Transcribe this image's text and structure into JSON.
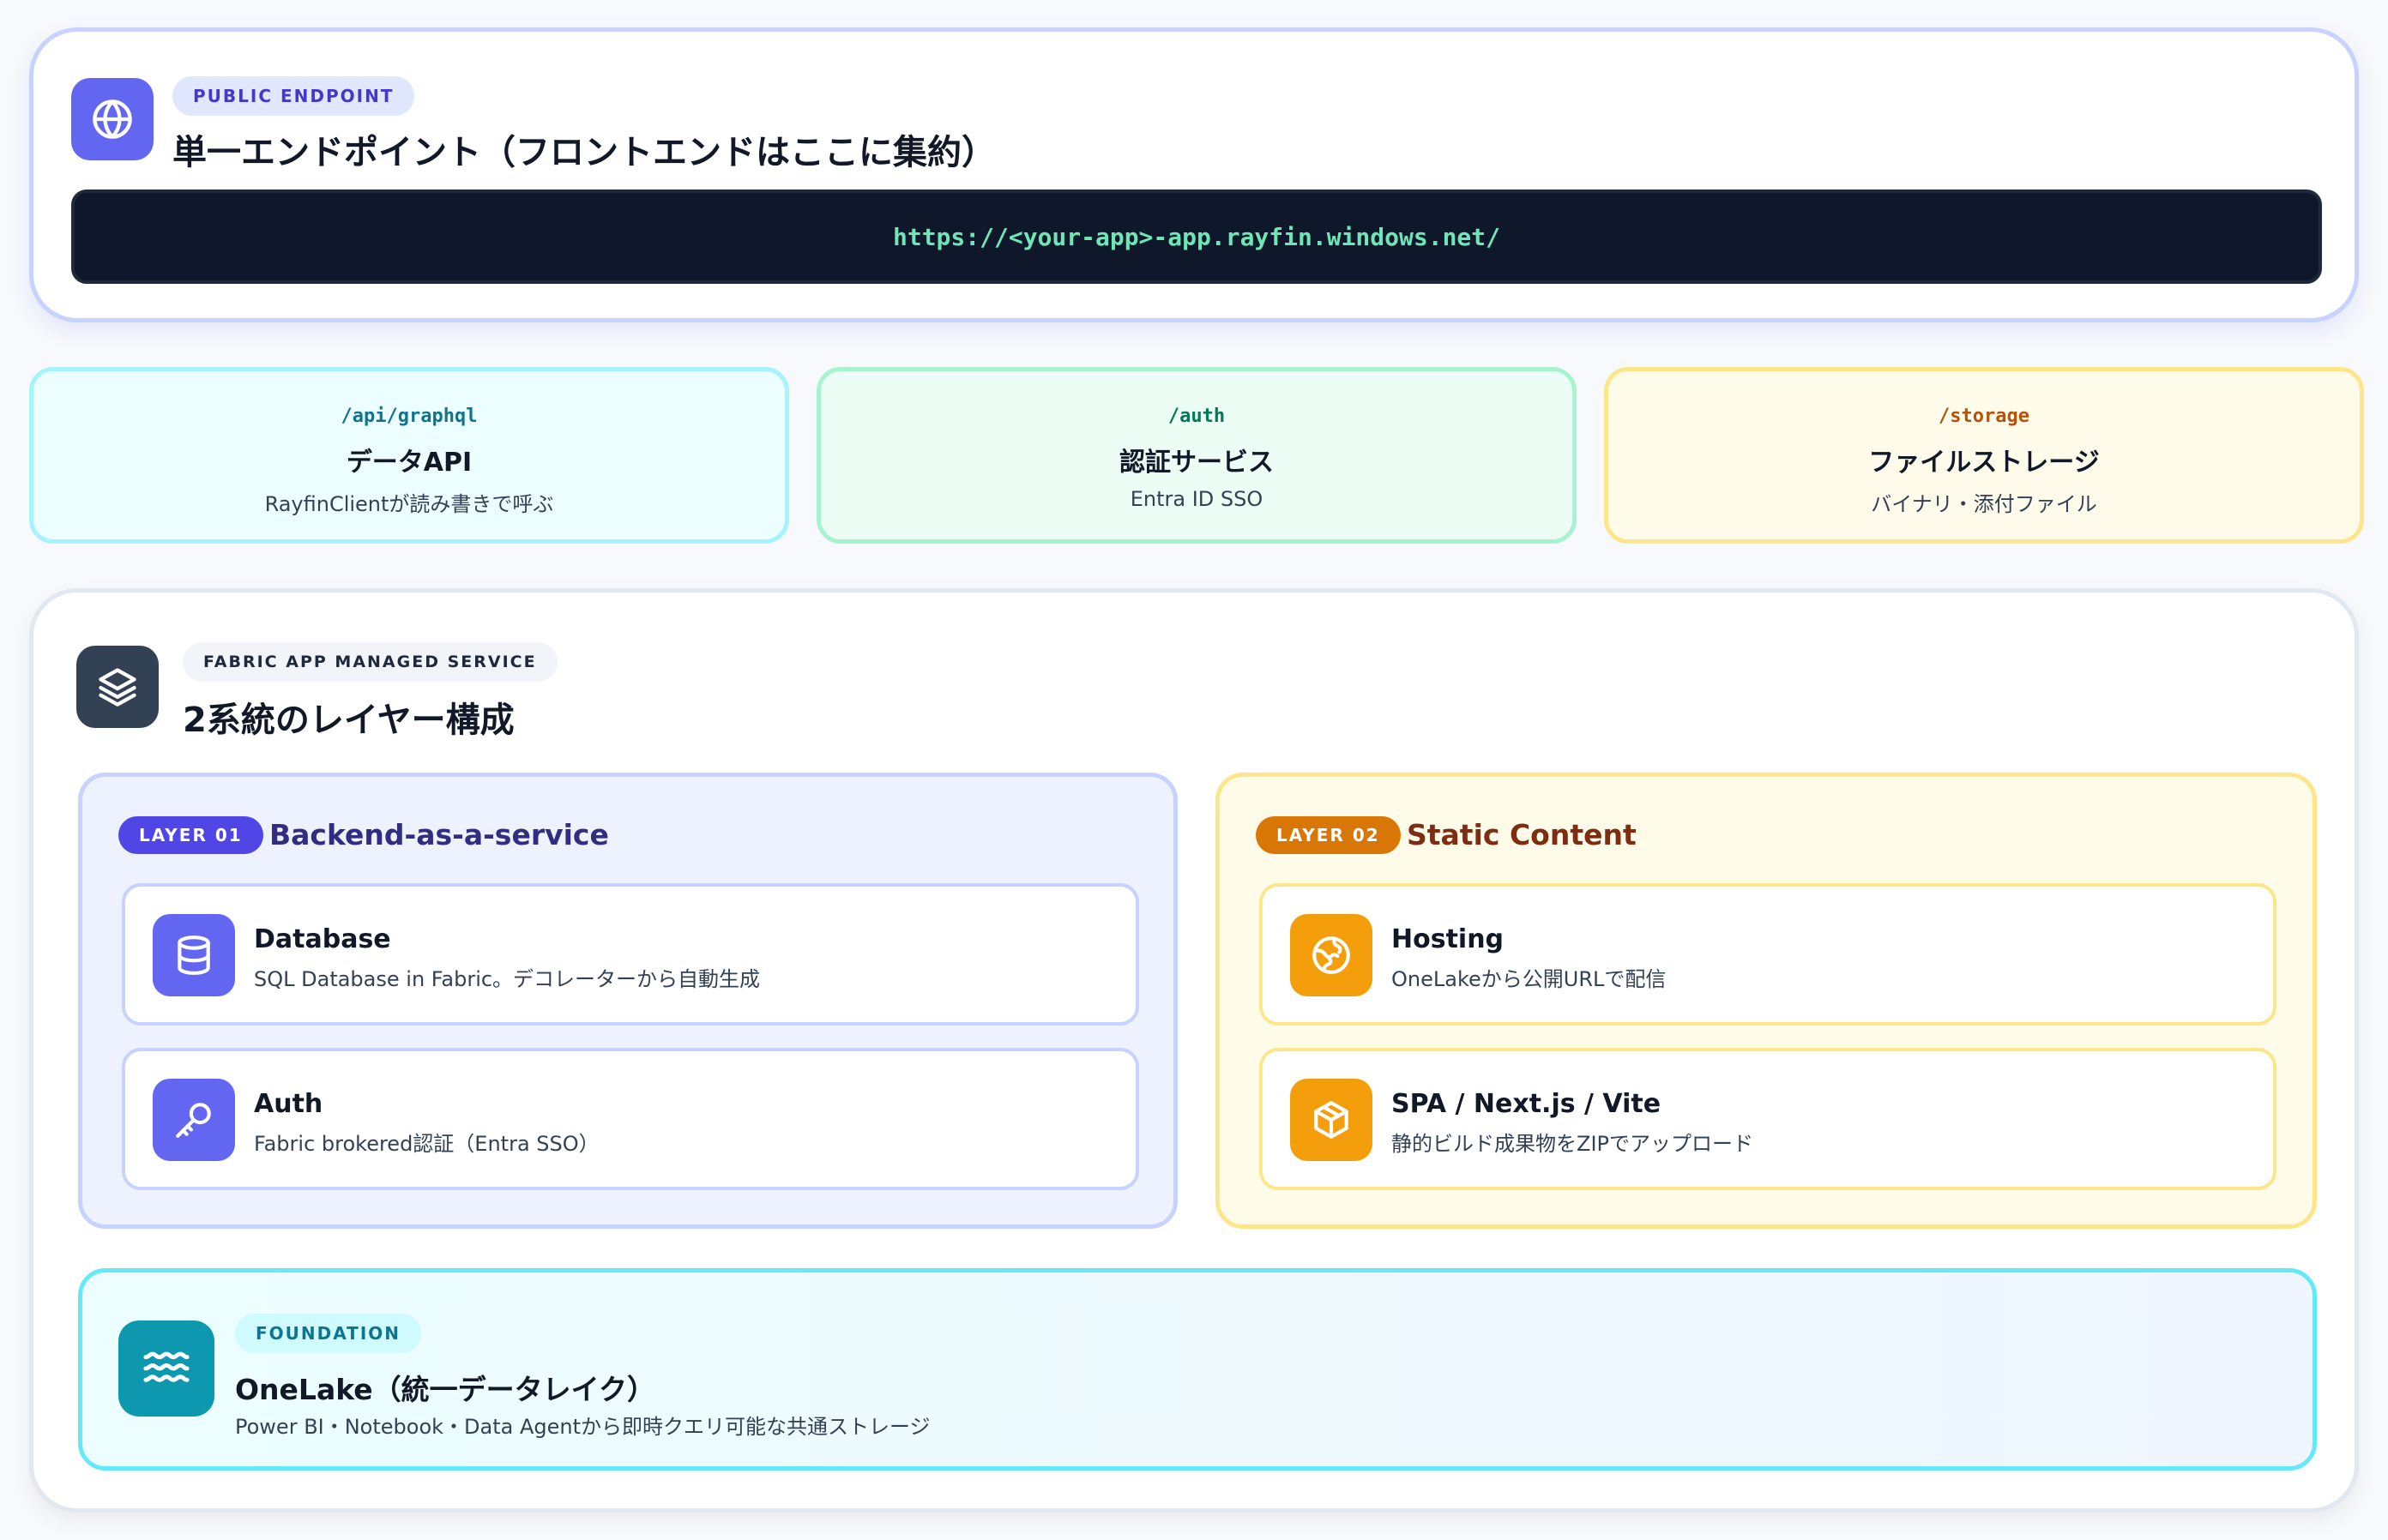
{
  "endpoint": {
    "badge": "PUBLIC ENDPOINT",
    "title": "単一エンドポイント（フロントエンドはここに集約）",
    "url": "https://<your-app>-app.rayfin.windows.net/",
    "icon": "globe-icon"
  },
  "routes": [
    {
      "path": "/api/graphql",
      "name": "データAPI",
      "desc": "RayfinClientが読み書きで呼ぶ",
      "color": "#0e7490"
    },
    {
      "path": "/auth",
      "name": "認証サービス",
      "desc": "Entra ID SSO",
      "color": "#047857"
    },
    {
      "path": "/storage",
      "name": "ファイルストレージ",
      "desc": "バイナリ・添付ファイル",
      "color": "#b45309"
    }
  ],
  "service": {
    "badge": "FABRIC APP MANAGED SERVICE",
    "title": "2系統のレイヤー構成",
    "icon": "layers-icon",
    "layers": [
      {
        "badge": "LAYER 01",
        "title": "Backend-as-a-service",
        "items": [
          {
            "name": "Database",
            "desc": "SQL Database in Fabric。デコレーターから自動生成",
            "icon": "database-icon"
          },
          {
            "name": "Auth",
            "desc": "Fabric brokered認証（Entra SSO）",
            "icon": "key-icon"
          }
        ]
      },
      {
        "badge": "LAYER 02",
        "title": "Static Content",
        "items": [
          {
            "name": "Hosting",
            "desc": "OneLakeから公開URLで配信",
            "icon": "globe-icon"
          },
          {
            "name": "SPA / Next.js / Vite",
            "desc": "静的ビルド成果物をZIPでアップロード",
            "icon": "package-icon"
          }
        ]
      }
    ],
    "foundation": {
      "badge": "FOUNDATION",
      "title": "OneLake（統一データレイク）",
      "desc": "Power BI・Notebook・Data Agentから即時クエリ可能な共通ストレージ",
      "icon": "waves-icon"
    }
  }
}
